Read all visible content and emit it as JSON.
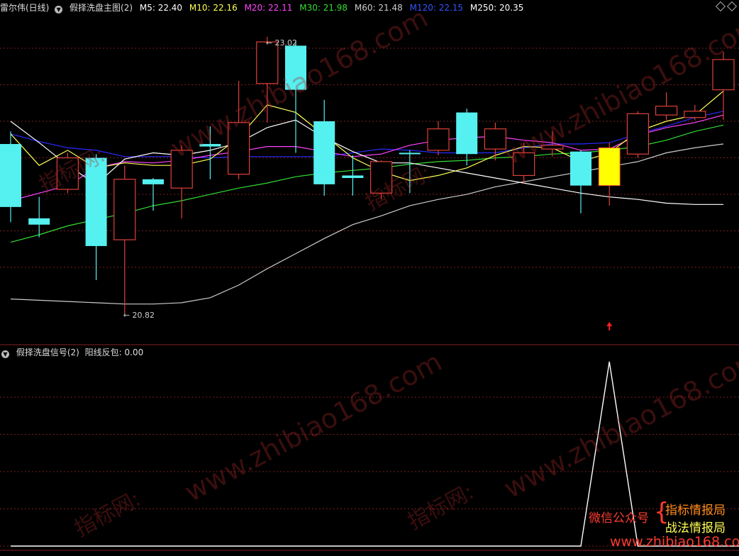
{
  "main_header": {
    "title": "雷尔伟(日线)",
    "indicator": "假择洗盘主图(2)",
    "ma": [
      {
        "label": "M5: 22.40",
        "color": "#ffffff"
      },
      {
        "label": "M10: 22.16",
        "color": "#ffff55"
      },
      {
        "label": "M20: 22.11",
        "color": "#ff44ff"
      },
      {
        "label": "M30: 21.98",
        "color": "#33dd33"
      },
      {
        "label": "M60: 21.48",
        "color": "#cccccc"
      },
      {
        "label": "M120: 22.15",
        "color": "#3333ff"
      },
      {
        "label": "M250: 20.35",
        "color": "#ffffff"
      }
    ]
  },
  "sub_header": {
    "indicator": "假择洗盘信号(2)",
    "value_label": "阳线反包: 0.00"
  },
  "annotations": {
    "high": "23.02",
    "low": "20.82"
  },
  "watermark": {
    "url": "www.zhibiao168.com",
    "cn": "指标网:"
  },
  "promo": {
    "wechat": "微信公众号",
    "line1": "指标情报局",
    "line2": "战法情报局",
    "url": "www.zhibiao168.com"
  },
  "colors": {
    "up": "#e0403a",
    "down": "#55f0f0",
    "signal": "#ffff00",
    "grid": "#7a1e1e"
  },
  "chart_data": {
    "type": "candlestick",
    "ylim": [
      20.6,
      23.2
    ],
    "candles": [
      {
        "o": 22.17,
        "h": 22.27,
        "l": 21.55,
        "c": 21.67
      },
      {
        "o": 21.58,
        "h": 21.75,
        "l": 21.43,
        "c": 21.53
      },
      {
        "o": 21.81,
        "h": 22.1,
        "l": 21.78,
        "c": 22.06
      },
      {
        "o": 22.06,
        "h": 22.09,
        "l": 21.09,
        "c": 21.36
      },
      {
        "o": 21.41,
        "h": 22.0,
        "l": 20.82,
        "c": 21.89
      },
      {
        "o": 21.89,
        "h": 21.9,
        "l": 21.64,
        "c": 21.85
      },
      {
        "o": 21.82,
        "h": 22.16,
        "l": 21.58,
        "c": 22.12
      },
      {
        "o": 22.17,
        "h": 22.31,
        "l": 21.89,
        "c": 22.15
      },
      {
        "o": 21.93,
        "h": 22.67,
        "l": 21.89,
        "c": 22.34
      },
      {
        "o": 22.65,
        "h": 23.02,
        "l": 22.34,
        "c": 22.98
      },
      {
        "o": 22.95,
        "h": 22.99,
        "l": 22.1,
        "c": 22.6
      },
      {
        "o": 22.35,
        "h": 22.52,
        "l": 21.76,
        "c": 21.85
      },
      {
        "o": 21.92,
        "h": 22.08,
        "l": 21.76,
        "c": 21.9
      },
      {
        "o": 21.78,
        "h": 22.04,
        "l": 21.73,
        "c": 22.03
      },
      {
        "o": 22.1,
        "h": 22.12,
        "l": 21.78,
        "c": 22.09
      },
      {
        "o": 22.12,
        "h": 22.35,
        "l": 22.08,
        "c": 22.29
      },
      {
        "o": 22.42,
        "h": 22.45,
        "l": 22.0,
        "c": 22.09
      },
      {
        "o": 22.13,
        "h": 22.34,
        "l": 22.04,
        "c": 22.29
      },
      {
        "o": 21.92,
        "h": 22.18,
        "l": 21.86,
        "c": 22.1
      },
      {
        "o": 22.13,
        "h": 22.27,
        "l": 22.07,
        "c": 22.16
      },
      {
        "o": 22.11,
        "h": 22.12,
        "l": 21.62,
        "c": 21.84
      },
      {
        "o": 21.84,
        "h": 22.18,
        "l": 21.68,
        "c": 22.14
      },
      {
        "o": 22.09,
        "h": 22.43,
        "l": 22.06,
        "c": 22.41
      },
      {
        "o": 22.4,
        "h": 22.58,
        "l": 22.36,
        "c": 22.47
      },
      {
        "o": 22.38,
        "h": 22.48,
        "l": 22.36,
        "c": 22.43
      },
      {
        "o": 22.6,
        "h": 22.9,
        "l": 22.36,
        "c": 22.84
      }
    ],
    "signal_index": 21,
    "series": [
      {
        "values": [
          22.35,
          22.18,
          22.0,
          21.85,
          22.05,
          22.1,
          22.08,
          22.12,
          22.18,
          22.3,
          22.36,
          22.22,
          22.11,
          22.02,
          22.02,
          21.98,
          21.94,
          21.9,
          21.86,
          21.82,
          21.78,
          21.75,
          21.73,
          21.7,
          21.69,
          21.69
        ]
      },
      {
        "values": [
          22.25,
          22.0,
          22.12,
          21.98,
          22.02,
          22.0,
          22.0,
          22.05,
          22.22,
          22.48,
          22.42,
          22.24,
          22.06,
          21.95,
          21.88,
          21.92,
          21.98,
          22.08,
          22.15,
          22.14,
          22.03,
          22.1,
          22.27,
          22.35,
          22.4,
          22.59
        ]
      },
      {
        "values": [
          21.72,
          21.78,
          21.84,
          21.98,
          22.03,
          22.02,
          22.04,
          22.08,
          22.11,
          22.15,
          22.15,
          22.11,
          22.07,
          22.09,
          22.16,
          22.2,
          22.22,
          22.23,
          22.2,
          22.18,
          22.12,
          22.13,
          22.24,
          22.3,
          22.34,
          22.4
        ]
      },
      {
        "values": [
          21.39,
          21.45,
          21.52,
          21.57,
          21.62,
          21.68,
          21.72,
          21.77,
          21.82,
          21.86,
          21.91,
          21.94,
          21.96,
          21.98,
          22.01,
          22.03,
          22.04,
          22.06,
          22.07,
          22.09,
          22.1,
          22.12,
          22.15,
          22.2,
          22.27,
          22.32
        ]
      },
      {
        "values": [
          20.94,
          20.93,
          20.92,
          20.91,
          20.9,
          20.9,
          20.91,
          20.95,
          21.05,
          21.18,
          21.3,
          21.42,
          21.53,
          21.6,
          21.68,
          21.73,
          21.77,
          21.83,
          21.87,
          21.91,
          21.95,
          21.99,
          22.03,
          22.1,
          22.14,
          22.17
        ]
      },
      {
        "values": [
          22.25,
          22.19,
          22.14,
          22.12,
          22.07,
          22.07,
          22.07,
          22.06,
          22.07,
          22.07,
          22.07,
          22.07,
          22.1,
          22.13,
          22.12,
          22.1,
          22.1,
          22.1,
          22.14,
          22.17,
          22.17,
          22.18,
          22.25,
          22.31,
          22.38,
          22.43
        ]
      }
    ],
    "signal_values": [
      0,
      0,
      0,
      0,
      0,
      0,
      0,
      0,
      0,
      0,
      0,
      0,
      0,
      0,
      0,
      0,
      0,
      0,
      0,
      0,
      0,
      1,
      0,
      0,
      0,
      0
    ],
    "signal_ylim": [
      0,
      1
    ]
  }
}
